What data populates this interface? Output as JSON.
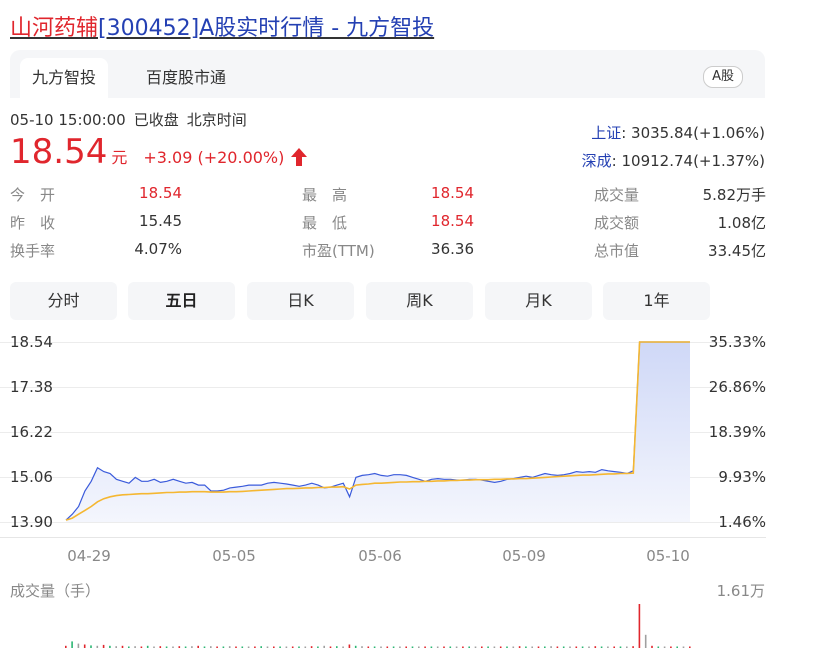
{
  "header": {
    "stock_name": "山河药辅",
    "title_rest": "[300452]A股实时行情 - 九方智投"
  },
  "tabs": [
    {
      "label": "九方智投",
      "active": true
    },
    {
      "label": "百度股市通",
      "active": false
    }
  ],
  "market_badge": "A股",
  "timestamp": {
    "datetime": "05-10 15:00:00",
    "status": "已收盘",
    "zone": "北京时间"
  },
  "quote": {
    "price": "18.54",
    "unit": "元",
    "change": "+3.09 (+20.00%)",
    "up_color": "#e0262d"
  },
  "indices": [
    {
      "name": "上证",
      "value": ": 3035.84(+1.06%)"
    },
    {
      "name": "深成",
      "value": ": 10912.74(+1.37%)"
    }
  ],
  "stats": {
    "open_label": "今　开",
    "open_value": "18.54",
    "prev_label": "昨　收",
    "prev_value": "15.45",
    "turnover_label": "换手率",
    "turnover_value": "4.07%",
    "high_label": "最　高",
    "high_value": "18.54",
    "low_label": "最　低",
    "low_value": "18.54",
    "pe_label": "市盈(TTM)",
    "pe_value": "36.36",
    "volume_label": "成交量",
    "volume_value": "5.82万手",
    "amount_label": "成交额",
    "amount_value": "1.08亿",
    "mcap_label": "总市值",
    "mcap_value": "33.45亿"
  },
  "periods": [
    {
      "label": "分时",
      "active": false
    },
    {
      "label": "五日",
      "active": true
    },
    {
      "label": "日K",
      "active": false
    },
    {
      "label": "周K",
      "active": false
    },
    {
      "label": "月K",
      "active": false
    },
    {
      "label": "1年",
      "active": false
    }
  ],
  "volume": {
    "label": "成交量（手）",
    "max_label": "1.61万"
  },
  "chart_data": {
    "type": "line",
    "title": "",
    "x_ticks": [
      "04-29",
      "05-05",
      "05-06",
      "05-09",
      "05-10"
    ],
    "y_ticks_left": [
      "18.54",
      "17.38",
      "16.22",
      "15.06",
      "13.90"
    ],
    "y_ticks_right": [
      "35.33%",
      "26.86%",
      "18.39%",
      "9.93%",
      "1.46%"
    ],
    "ylim": [
      13.9,
      18.54
    ],
    "grid": true,
    "series": [
      {
        "color": "#3b5bdb",
        "values": [
          13.95,
          14.1,
          14.3,
          14.7,
          14.95,
          15.3,
          15.2,
          15.15,
          15.0,
          14.95,
          14.9,
          15.05,
          14.95,
          14.95,
          15.0,
          14.92,
          14.95,
          15.0,
          14.95,
          14.9,
          14.92,
          14.85,
          14.85,
          14.7,
          14.7,
          14.72,
          14.78,
          14.8,
          14.82,
          14.85,
          14.85,
          14.85,
          14.9,
          14.92,
          14.9,
          14.88,
          14.85,
          14.82,
          14.85,
          14.9,
          14.85,
          14.78,
          14.8,
          14.85,
          14.9,
          14.55,
          15.05,
          15.1,
          15.12,
          15.15,
          15.1,
          15.08,
          15.12,
          15.12,
          15.1,
          15.05,
          15.0,
          14.95,
          15.0,
          15.02,
          15.0,
          15.0,
          14.98,
          14.98,
          15.0,
          15.0,
          14.98,
          14.95,
          14.92,
          14.95,
          15.0,
          15.02,
          15.05,
          15.08,
          15.05,
          15.1,
          15.15,
          15.12,
          15.1,
          15.12,
          15.15,
          15.2,
          15.18,
          15.2,
          15.18,
          15.25,
          15.22,
          15.2,
          15.18,
          15.15,
          15.22,
          18.54,
          18.54,
          18.54,
          18.54,
          18.54,
          18.54,
          18.54,
          18.54,
          18.54
        ]
      },
      {
        "color": "#f5b731",
        "values": [
          13.95,
          14.0,
          14.1,
          14.2,
          14.3,
          14.42,
          14.5,
          14.55,
          14.58,
          14.6,
          14.61,
          14.62,
          14.63,
          14.63,
          14.64,
          14.65,
          14.66,
          14.66,
          14.67,
          14.67,
          14.68,
          14.68,
          14.68,
          14.67,
          14.67,
          14.67,
          14.68,
          14.68,
          14.69,
          14.7,
          14.71,
          14.72,
          14.73,
          14.74,
          14.75,
          14.76,
          14.76,
          14.77,
          14.78,
          14.78,
          14.79,
          14.79,
          14.8,
          14.8,
          14.81,
          14.75,
          14.85,
          14.87,
          14.88,
          14.9,
          14.9,
          14.91,
          14.92,
          14.93,
          14.93,
          14.94,
          14.94,
          14.95,
          14.95,
          14.96,
          14.96,
          14.97,
          14.97,
          14.98,
          14.98,
          14.99,
          14.99,
          14.99,
          15.0,
          15.0,
          15.01,
          15.01,
          15.02,
          15.02,
          15.03,
          15.04,
          15.05,
          15.06,
          15.07,
          15.08,
          15.09,
          15.1,
          15.11,
          15.11,
          15.12,
          15.13,
          15.14,
          15.14,
          15.15,
          15.15,
          15.16,
          18.54,
          18.54,
          18.54,
          18.54,
          18.54,
          18.54,
          18.54,
          18.54,
          18.54
        ]
      }
    ],
    "volume_values": [
      0.05,
      0.15,
      0.1,
      0.08,
      0.06,
      0.05,
      0.07,
      0.05,
      0.04,
      0.05,
      0.03,
      0.04,
      0.03,
      0.05,
      0.03,
      0.04,
      0.03,
      0.03,
      0.04,
      0.03,
      0.04,
      0.05,
      0.03,
      0.04,
      0.03,
      0.03,
      0.04,
      0.03,
      0.02,
      0.03,
      0.03,
      0.04,
      0.03,
      0.03,
      0.02,
      0.03,
      0.03,
      0.02,
      0.03,
      0.04,
      0.03,
      0.05,
      0.03,
      0.04,
      0.03,
      0.08,
      0.05,
      0.04,
      0.03,
      0.03,
      0.02,
      0.03,
      0.02,
      0.02,
      0.03,
      0.02,
      0.03,
      0.03,
      0.02,
      0.02,
      0.03,
      0.02,
      0.02,
      0.03,
      0.02,
      0.02,
      0.03,
      0.02,
      0.02,
      0.03,
      0.02,
      0.03,
      0.04,
      0.02,
      0.03,
      0.02,
      0.03,
      0.04,
      0.03,
      0.02,
      0.03,
      0.02,
      0.03,
      0.02,
      0.04,
      0.03,
      0.02,
      0.03,
      0.02,
      0.03,
      0.04,
      1.0,
      0.3,
      0.05,
      0.02,
      0.02,
      0.02,
      0.02,
      0.02,
      0.02
    ]
  }
}
